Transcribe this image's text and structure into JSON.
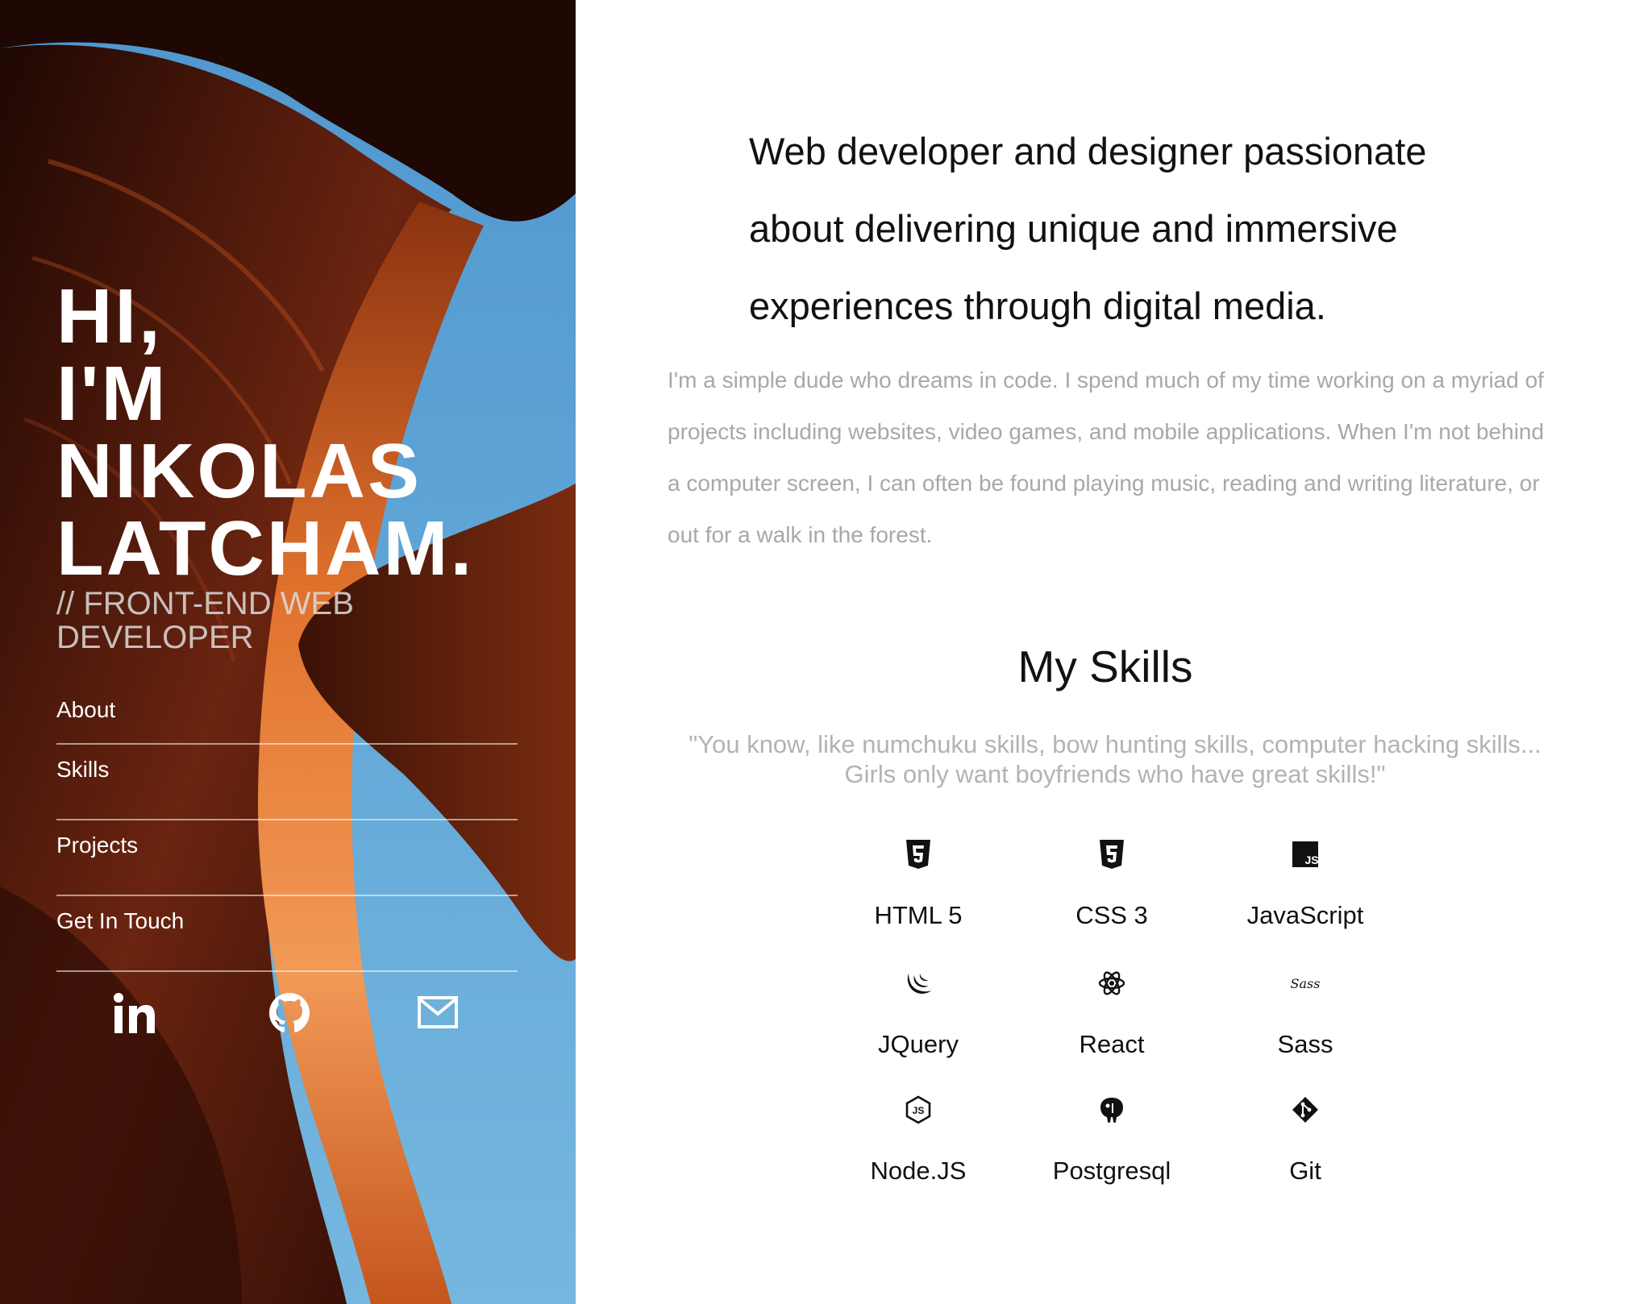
{
  "hero": {
    "title_lines": [
      "HI,",
      "I'M",
      "NIKOLAS",
      "LATCHAM."
    ],
    "subtitle": "// FRONT-END WEB DEVELOPER"
  },
  "nav": {
    "items": [
      {
        "label": "About"
      },
      {
        "label": "Skills"
      },
      {
        "label": "Projects"
      },
      {
        "label": "Get In Touch"
      }
    ]
  },
  "social": {
    "icons": [
      "linkedin-icon",
      "github-icon",
      "mail-icon"
    ]
  },
  "intro": {
    "text": "Web developer and designer passionate about delivering unique and immersive experiences through digital media."
  },
  "bio": {
    "text": "I'm a simple dude who dreams in code. I spend much of my time working on a myriad of projects including websites, video games, and mobile applications. When I'm not behind a computer screen, I can often be found playing music, reading and writing literature, or out for a walk in the forest."
  },
  "skills": {
    "title": "My Skills",
    "quote_line1": "\"You know, like numchuku skills, bow hunting skills, computer hacking skills...",
    "quote_line2": "Girls only want boyfriends who have great skills!\"",
    "items": [
      {
        "label": "HTML 5",
        "icon": "html5-icon"
      },
      {
        "label": "CSS 3",
        "icon": "css3-icon"
      },
      {
        "label": "JavaScript",
        "icon": "javascript-icon"
      },
      {
        "label": "JQuery",
        "icon": "jquery-icon"
      },
      {
        "label": "React",
        "icon": "react-icon"
      },
      {
        "label": "Sass",
        "icon": "sass-icon"
      },
      {
        "label": "Node.JS",
        "icon": "nodejs-icon"
      },
      {
        "label": "Postgresql",
        "icon": "postgresql-icon"
      },
      {
        "label": "Git",
        "icon": "git-icon"
      }
    ]
  },
  "colors": {
    "sky": "#5ea7d8",
    "rock_dark": "#2a0c05",
    "rock_orange": "#d96a2a",
    "text_dark": "#111111",
    "text_muted": "#a8a8a8"
  }
}
